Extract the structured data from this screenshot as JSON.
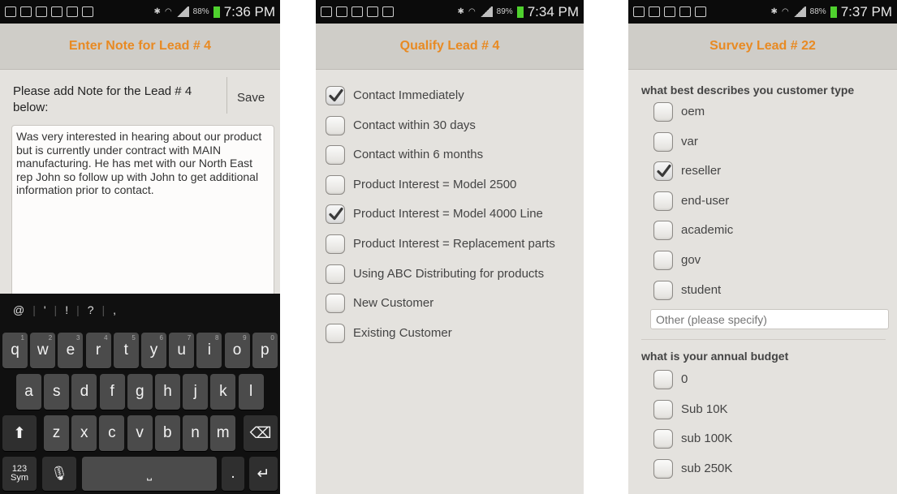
{
  "status": {
    "screen1": {
      "battery": "88%",
      "time": "7:36 PM"
    },
    "screen2": {
      "battery": "89%",
      "time": "7:34 PM"
    },
    "screen3": {
      "battery": "88%",
      "time": "7:37 PM"
    }
  },
  "note_screen": {
    "title": "Enter Note for Lead # 4",
    "prompt": "Please add Note for the Lead # 4 below:",
    "save_label": "Save",
    "note_value": "Was very interested in hearing about our product but is currently under contract with MAIN manufacturing.  He has met with our North East rep John so follow up with John to get additional information prior to contact.",
    "keyboard": {
      "suggestions": [
        "@",
        "'",
        "!",
        "?",
        ","
      ],
      "row1": [
        "q",
        "w",
        "e",
        "r",
        "t",
        "y",
        "u",
        "i",
        "o",
        "p"
      ],
      "row1_sub": [
        "1",
        "2",
        "3",
        "4",
        "5",
        "6",
        "7",
        "8",
        "9",
        "0"
      ],
      "row2": [
        "a",
        "s",
        "d",
        "f",
        "g",
        "h",
        "j",
        "k",
        "l"
      ],
      "row3": [
        "z",
        "x",
        "c",
        "v",
        "b",
        "n",
        "m"
      ],
      "sym_label_1": "123",
      "sym_label_2": "Sym",
      "period": "."
    }
  },
  "qualify_screen": {
    "title": "Qualify Lead # 4",
    "options": [
      {
        "label": "Contact Immediately",
        "checked": true
      },
      {
        "label": "Contact within 30 days",
        "checked": false
      },
      {
        "label": "Contact within 6 months",
        "checked": false
      },
      {
        "label": "Product Interest = Model 2500",
        "checked": false
      },
      {
        "label": "Product Interest = Model 4000 Line",
        "checked": true
      },
      {
        "label": "Product Interest = Replacement parts",
        "checked": false
      },
      {
        "label": "Using ABC Distributing for products",
        "checked": false
      },
      {
        "label": "New Customer",
        "checked": false
      },
      {
        "label": "Existing Customer",
        "checked": false
      }
    ]
  },
  "survey_screen": {
    "title": "Survey Lead # 22",
    "question1": "what best describes you customer type",
    "q1_options": [
      {
        "label": "oem",
        "checked": false
      },
      {
        "label": "var",
        "checked": false
      },
      {
        "label": "reseller",
        "checked": true
      },
      {
        "label": "end-user",
        "checked": false
      },
      {
        "label": "academic",
        "checked": false
      },
      {
        "label": "gov",
        "checked": false
      },
      {
        "label": "student",
        "checked": false
      }
    ],
    "other_placeholder": "Other (please specify)",
    "question2": "what is your annual budget",
    "q2_options": [
      {
        "label": "0",
        "checked": false
      },
      {
        "label": "Sub 10K",
        "checked": false
      },
      {
        "label": "sub 100K",
        "checked": false
      },
      {
        "label": "sub 250K",
        "checked": false
      }
    ]
  }
}
